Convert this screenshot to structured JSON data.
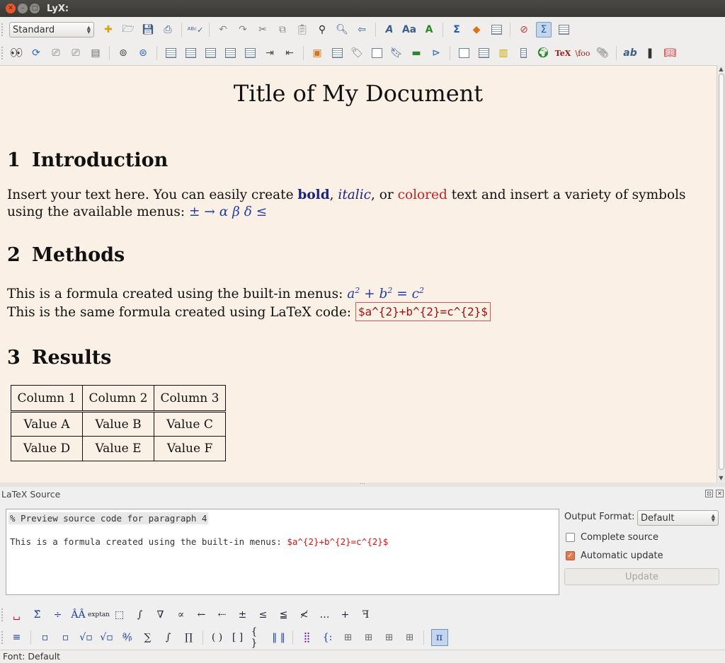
{
  "window": {
    "title": "LyX:"
  },
  "toolbar": {
    "style_select": "Standard",
    "row1_icons": [
      "new-document-icon",
      "open-icon",
      "save-icon",
      "print-icon",
      "spellcheck-icon",
      "undo-icon",
      "redo-icon",
      "cut-icon",
      "copy-icon",
      "paste-icon",
      "find-icon",
      "find-replace-icon",
      "go-back-icon",
      "emphasis-icon",
      "noun-icon",
      "apply-style-icon",
      "math-icon",
      "insert-graphics-icon",
      "insert-table-icon",
      "navigate-icon",
      "toggle-source-icon",
      "toggle-outline-icon"
    ],
    "row2_icons": [
      "view-icon",
      "update-icon",
      "view-master-icon",
      "update-master-icon",
      "view-other-icon",
      "preview-icon",
      "refresh-preview-icon",
      "align-left-icon",
      "numbered-list-icon",
      "itemize-icon",
      "description-icon",
      "enumerate-icon",
      "depth-increase-icon",
      "depth-decrease-icon",
      "insert-figure-icon",
      "insert-table-float-icon",
      "label-icon",
      "cross-ref-icon",
      "citation-icon",
      "index-icon",
      "hyperlink-icon",
      "footnote-icon",
      "margin-note-icon",
      "note-icon",
      "box-icon",
      "insert-url-icon",
      "tex-code-icon",
      "vfoo-icon",
      "attach-icon",
      "spelling-icon",
      "thesaurus-icon",
      "book-icon"
    ]
  },
  "document": {
    "title": "Title of My Document",
    "sections": [
      {
        "number": "1",
        "title": "Introduction"
      },
      {
        "number": "2",
        "title": "Methods"
      },
      {
        "number": "3",
        "title": "Results"
      }
    ],
    "intro": {
      "part1": "Insert your text here. You can easily create ",
      "bold": "bold",
      "comma1": ", ",
      "italic": "italic",
      "part2": ", or ",
      "colored": "colored",
      "part3": " text and insert a variety of symbols using the available menus: ",
      "symbols": "±  →  α  β  δ  ≤"
    },
    "methods": {
      "line1": "This is a formula created using the built-in menus: ",
      "line2": "This is the same formula created using LaTeX code: ",
      "ert": "$a^{2}+b^{2}=c^{2}$"
    },
    "table": {
      "headers": [
        "Column 1",
        "Column 2",
        "Column 3"
      ],
      "rows": [
        [
          "Value A",
          "Value B",
          "Value C"
        ],
        [
          "Value D",
          "Value E",
          "Value F"
        ]
      ]
    }
  },
  "source_panel": {
    "title": "LaTeX Source",
    "line1": "% Preview source code for paragraph 4",
    "line2": "This is a formula created using the built-in menus: ",
    "line2_math": "$a^{2}+b^{2}=c^{2}$",
    "output_format_label": "Output Format:",
    "output_format_value": "Default",
    "complete_source_label": "Complete source",
    "complete_source_checked": false,
    "automatic_update_label": "Automatic update",
    "automatic_update_checked": true,
    "update_button": "Update"
  },
  "math_toolbar": {
    "row1": [
      "␣",
      "Σ̂",
      "÷",
      "ÂÂ",
      "exp",
      "⬚",
      "∫",
      "∇",
      "∝",
      "←",
      "⇠",
      "±",
      "≤",
      "≦",
      "≮",
      "…",
      "+",
      "ꟻ"
    ],
    "exp_top": "exp",
    "exp_bottom": "tan",
    "row2": [
      "≡",
      "▫",
      "▫",
      "√▫",
      "√▫",
      "ª⁄ᵦ",
      "∑",
      "∫",
      "∏",
      "( )",
      "[ ]",
      "{ }",
      "‖ ‖",
      "⣿",
      "{:",
      "⊞",
      "⊞",
      "⊞",
      "⊞",
      "π"
    ]
  },
  "status": {
    "text": "Font: Default"
  }
}
